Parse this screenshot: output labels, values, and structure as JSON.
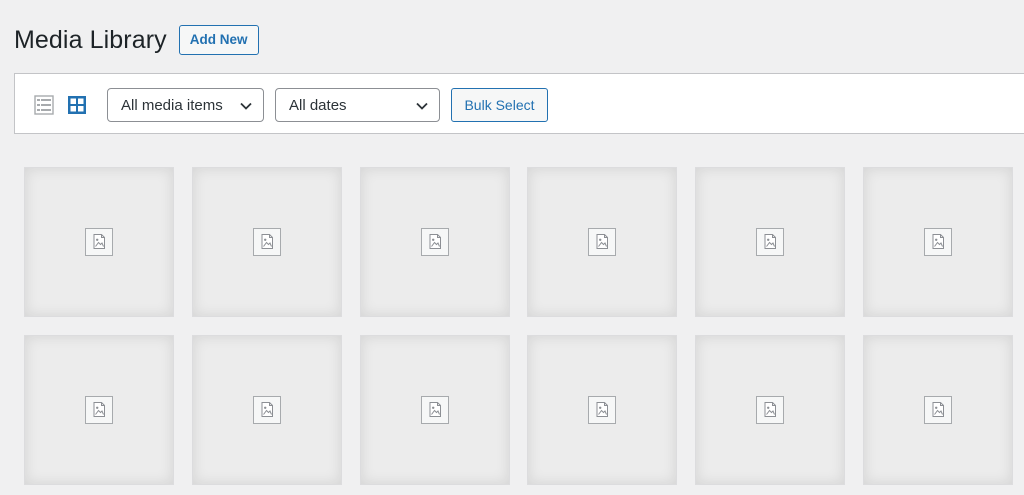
{
  "page": {
    "title": "Media Library",
    "add_new_label": "Add New"
  },
  "toolbar": {
    "views": [
      {
        "name": "list-view",
        "icon": "list-view-icon",
        "active": false
      },
      {
        "name": "grid-view",
        "icon": "grid-view-icon",
        "active": true
      }
    ],
    "media_type_filter": "All media items",
    "date_filter": "All dates",
    "bulk_select_label": "Bulk Select"
  },
  "media_grid": {
    "rows": 2,
    "columns": 6,
    "placeholder_icon": "broken-image-icon"
  },
  "colors": {
    "accent": "#2271b1",
    "background": "#f0f0f1",
    "tile_background": "#ececec",
    "inactive_icon": "#a7aaad"
  }
}
